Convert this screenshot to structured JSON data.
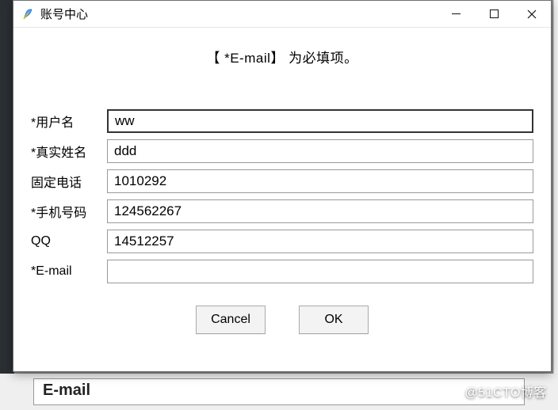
{
  "window": {
    "title": "账号中心"
  },
  "message": "【 *E-mail】 为必填项。",
  "fields": {
    "username": {
      "label": "*用户名",
      "value": "ww"
    },
    "realname": {
      "label": "*真实姓名",
      "value": "ddd"
    },
    "landline": {
      "label": " 固定电话",
      "value": "1010292"
    },
    "mobile": {
      "label": "*手机号码",
      "value": "124562267"
    },
    "qq": {
      "label": " QQ",
      "value": "14512257"
    },
    "email": {
      "label": "*E-mail",
      "value": ""
    }
  },
  "buttons": {
    "cancel": "Cancel",
    "ok": "OK"
  },
  "backdrop": {
    "bg_label": "E-mail"
  },
  "watermark": "@51CTO博客"
}
